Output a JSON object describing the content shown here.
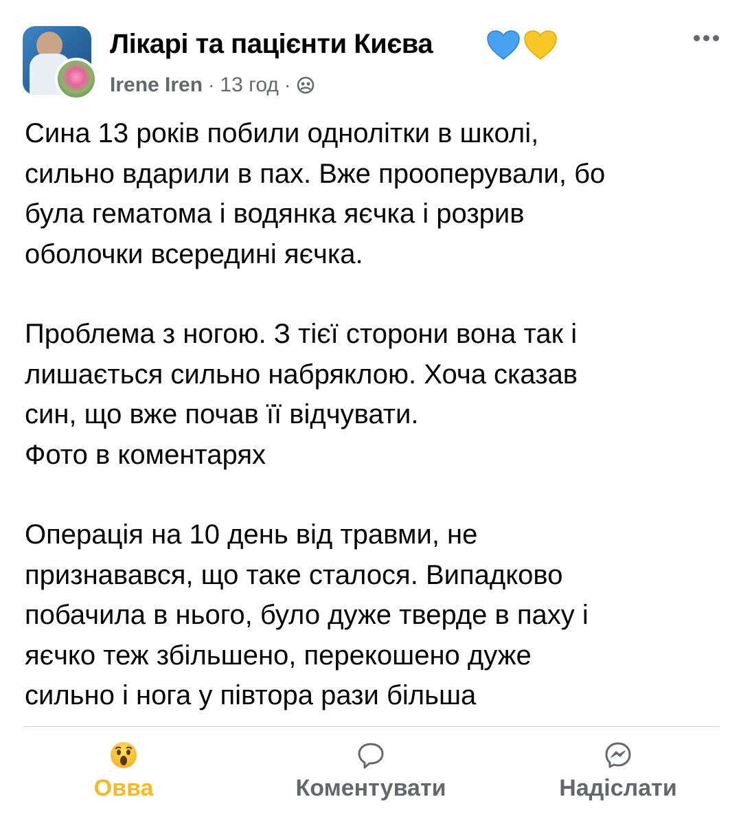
{
  "header": {
    "group_name": "Лікарі та пацієнти Києва",
    "hearts": [
      "blue-heart-icon",
      "yellow-heart-icon"
    ],
    "author": "Irene Iren",
    "separator": "·",
    "time": "13 год",
    "privacy_icon": "group-privacy-icon"
  },
  "post": {
    "paragraphs": [
      [
        "Сина 13 років побили однолітки в школі,",
        "сильно вдарили в пах. Вже прооперували, бо",
        "була гематома і водянка яєчка і розрив",
        "оболочки всередині яєчка."
      ],
      [
        "Проблема з ногою. З тієї сторони вона так і",
        "лишається сильно набряклою. Хоча сказав",
        "син, що вже почав її відчувати.",
        "Фото в коментарях"
      ],
      [
        "Операція на 10 день від травми, не",
        "признавався, що таке сталося. Випадково",
        "побачила в нього, було дуже тверде в паху і",
        "яєчко теж збільшено, перекошено дуже",
        "сильно і нога у півтора рази більша"
      ]
    ]
  },
  "actions": {
    "react_label": "Овва",
    "react_icon": "wow-emoji-icon",
    "comment_label": "Коментувати",
    "comment_icon": "comment-bubble-icon",
    "send_label": "Надіслати",
    "send_icon": "messenger-icon"
  },
  "colors": {
    "text": "#050505",
    "secondary": "#65676b",
    "reaction": "#f7b928",
    "divider": "#ced0d4",
    "heart_blue": "#4aa3f0",
    "heart_yellow": "#f7c825"
  }
}
